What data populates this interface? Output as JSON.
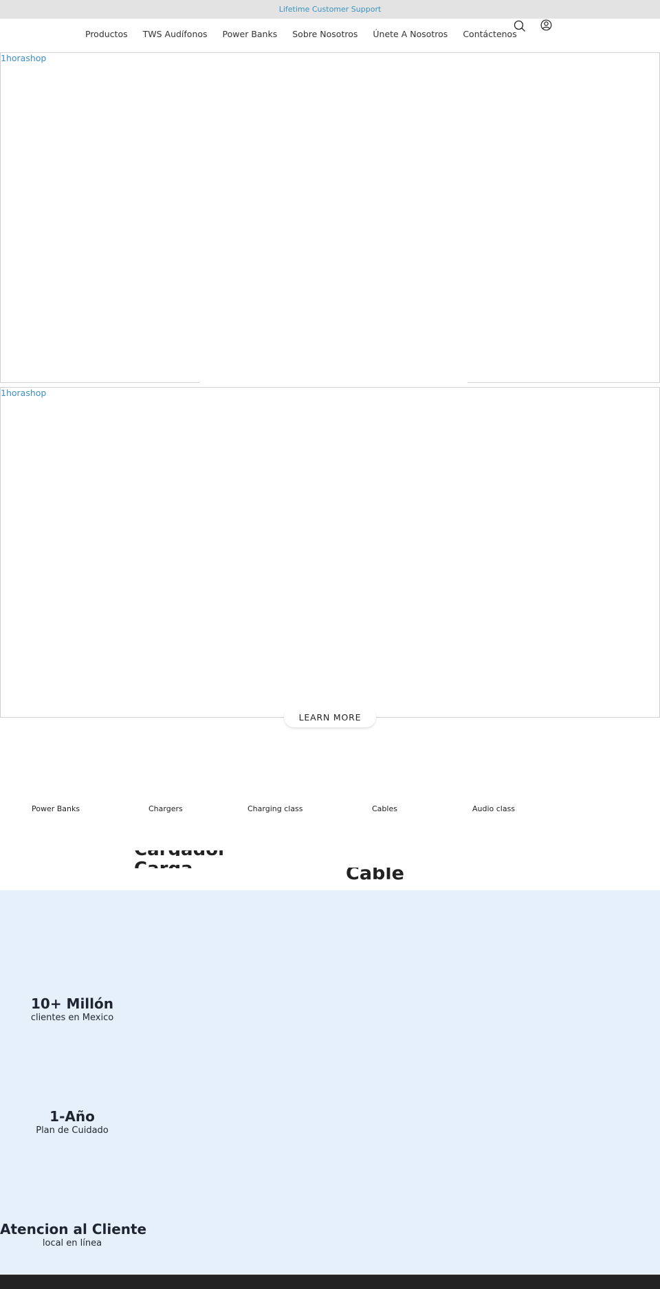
{
  "announcement": {
    "text": "Lifetime Customer Support",
    "color": "#3a93bf"
  },
  "nav": {
    "links": [
      {
        "label": "Productos"
      },
      {
        "label": "TWS Audífonos"
      },
      {
        "label": "Power Banks"
      },
      {
        "label": "Sobre Nosotros"
      },
      {
        "label": "Únete A Nosotros"
      },
      {
        "label": "Contáctenos"
      }
    ],
    "icons": {
      "search": "search-icon",
      "account": "account-icon"
    }
  },
  "hero": {
    "banners": [
      {
        "alt": "1horashop"
      },
      {
        "alt": "1horashop"
      }
    ],
    "learn_more_label": "LEARN MORE"
  },
  "categories": [
    {
      "label": "Power Banks"
    },
    {
      "label": "Chargers"
    },
    {
      "label": "Charging class"
    },
    {
      "label": "Cables"
    },
    {
      "label": "Audio class"
    }
  ],
  "clipped_headings": [
    {
      "text": "Cargador"
    },
    {
      "text": "Carga"
    },
    {
      "text": "Cable"
    }
  ],
  "stats": [
    {
      "title": "10+ Millón",
      "subtitle": "clientes en Mexico"
    },
    {
      "title": "1-Año",
      "subtitle": "Plan de Cuidado"
    },
    {
      "title": "Atencion al Cliente",
      "subtitle": "local en línea"
    }
  ],
  "colors": {
    "stats_bg": "#e6f0fb",
    "footer_bg": "#222222",
    "link_blue": "#3a8fbf"
  }
}
